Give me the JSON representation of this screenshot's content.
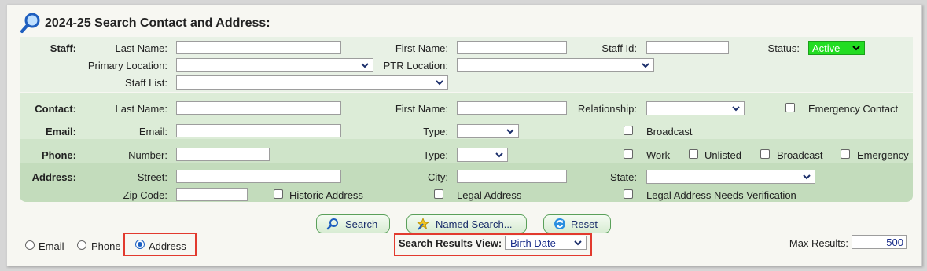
{
  "title": "2024-25 Search Contact and Address:",
  "staff": {
    "section": "Staff:",
    "last_name": "Last Name:",
    "first_name": "First Name:",
    "staff_id": "Staff Id:",
    "status": "Status:",
    "status_value": "Active",
    "primary_location": "Primary Location:",
    "ptr_location": "PTR Location:",
    "staff_list": "Staff List:"
  },
  "contact": {
    "section": "Contact:",
    "last_name": "Last Name:",
    "first_name": "First Name:",
    "relationship": "Relationship:",
    "emergency_contact": "Emergency Contact"
  },
  "email": {
    "section": "Email:",
    "email": "Email:",
    "type": "Type:",
    "broadcast": "Broadcast"
  },
  "phone": {
    "section": "Phone:",
    "number": "Number:",
    "type": "Type:",
    "work": "Work",
    "unlisted": "Unlisted",
    "broadcast": "Broadcast",
    "emergency": "Emergency"
  },
  "address": {
    "section": "Address:",
    "street": "Street:",
    "city": "City:",
    "state": "State:",
    "zip": "Zip Code:",
    "historic": "Historic Address",
    "legal": "Legal Address",
    "legal_verify": "Legal Address Needs Verification"
  },
  "buttons": {
    "search": "Search",
    "named_search": "Named Search...",
    "reset": "Reset"
  },
  "results": {
    "radio_email": "Email",
    "radio_phone": "Phone",
    "radio_address": "Address",
    "selected": "Address",
    "view_label": "Search Results View:",
    "view_value": "Birth Date",
    "max_label": "Max Results:",
    "max_value": "500"
  },
  "colors": {
    "status_green": "#22dd22",
    "highlight_red": "#e23a2e",
    "button_text": "#1a2d6a"
  }
}
